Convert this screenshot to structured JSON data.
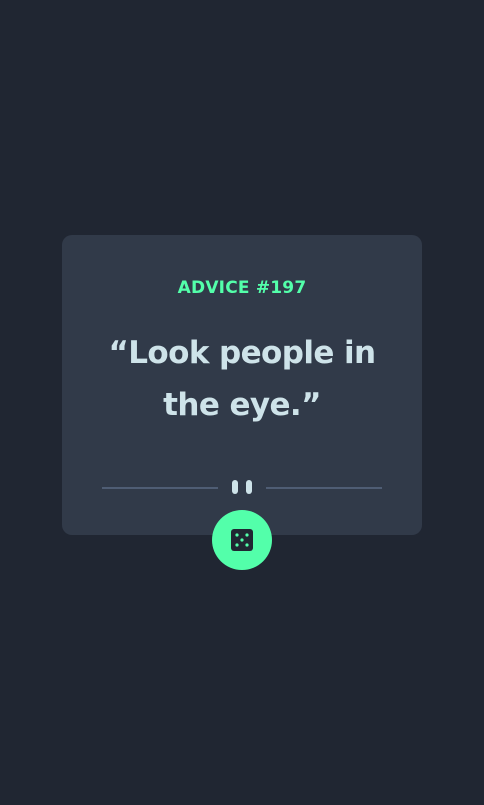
{
  "advice": {
    "label": "ADVICE #197",
    "quote": "“Look people in the eye.”"
  },
  "colors": {
    "background": "#202632",
    "card": "#313a49",
    "accent": "#53ffaa",
    "text": "#cee3e9",
    "divider": "#4f5d74"
  },
  "icons": {
    "divider_ornament": "pause-icon",
    "button": "dice-icon"
  }
}
